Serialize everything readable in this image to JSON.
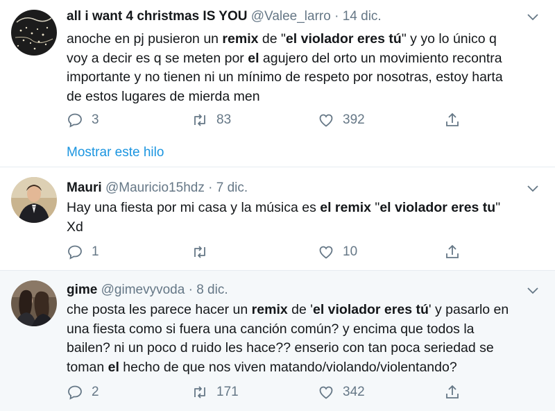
{
  "tweets": [
    {
      "name": "all i want 4 christmas IS YOU",
      "handle": "@Valee_larro",
      "sep": "·",
      "date": "14 dic.",
      "lines": [
        [
          {
            "t": "anoche en pj pusieron un "
          },
          {
            "t": "remix",
            "b": true
          },
          {
            "t": " de \""
          },
          {
            "t": "el violador eres tú",
            "b": true
          },
          {
            "t": "\" y yo lo único q"
          }
        ],
        [
          {
            "t": "voy a decir es q se meten por "
          },
          {
            "t": "el",
            "b": true
          },
          {
            "t": " agujero del orto un movimiento recontra"
          }
        ],
        [
          {
            "t": "importante y no tienen ni un mínimo de respeto por nosotras, estoy harta"
          }
        ],
        [
          {
            "t": "de estos lugares de mierda men"
          }
        ]
      ],
      "replies": "3",
      "retweets": "83",
      "likes": "392",
      "thread_link": "Mostrar este hilo"
    },
    {
      "name": "Mauri",
      "handle": "@Mauricio15hdz",
      "sep": "·",
      "date": "7 dic.",
      "lines": [
        [
          {
            "t": "Hay una fiesta por mi casa y la música es "
          },
          {
            "t": "el remix",
            "b": true
          },
          {
            "t": " \""
          },
          {
            "t": "el violador eres tu",
            "b": true
          },
          {
            "t": "\""
          }
        ],
        [
          {
            "t": "Xd"
          }
        ]
      ],
      "replies": "1",
      "retweets": "",
      "likes": "10"
    },
    {
      "name": "gime",
      "handle": "@gimevyvoda",
      "sep": "·",
      "date": "8 dic.",
      "lines": [
        [
          {
            "t": "che posta les parece hacer un "
          },
          {
            "t": "remix",
            "b": true
          },
          {
            "t": " de '"
          },
          {
            "t": "el violador eres tú",
            "b": true
          },
          {
            "t": "' y pasarlo en"
          }
        ],
        [
          {
            "t": "una fiesta como si fuera una canción común? y encima que todos la"
          }
        ],
        [
          {
            "t": "bailen? ni un poco d ruido les hace?? enserio con tan poca seriedad se"
          }
        ],
        [
          {
            "t": "toman "
          },
          {
            "t": "el",
            "b": true
          },
          {
            "t": " hecho de que nos viven matando/violando/violentando?"
          }
        ]
      ],
      "replies": "2",
      "retweets": "171",
      "likes": "342"
    }
  ],
  "icons": {
    "reply": "reply-icon",
    "retweet": "retweet-icon",
    "like": "heart-icon",
    "share": "share-icon",
    "more": "chevron-down-icon"
  },
  "colors": {
    "link": "#1b95e0",
    "secondary_text": "#657786",
    "highlight_bg": "#f5f8fa"
  }
}
